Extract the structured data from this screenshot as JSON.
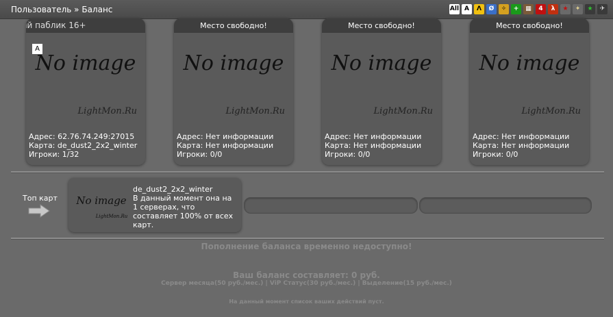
{
  "header": {
    "breadcrumb": "Пользователь » Баланс",
    "game_icons": [
      {
        "name": "all-games-icon",
        "glyph": "All",
        "bg": "#ffffff",
        "fg": "#000000"
      },
      {
        "name": "cs16-icon",
        "glyph": "A",
        "bg": "#ffffff",
        "fg": "#000000"
      },
      {
        "name": "cs16-alt-icon",
        "glyph": "Λ",
        "bg": "#f0c010",
        "fg": "#000000"
      },
      {
        "name": "source-icon",
        "glyph": "Ø",
        "bg": "#3a6fc8",
        "fg": "#ffffff"
      },
      {
        "name": "cs-go-icon",
        "glyph": "✧",
        "bg": "#d4a020",
        "fg": "#000000"
      },
      {
        "name": "mod-plus-icon",
        "glyph": "+",
        "bg": "#1a9a1a",
        "fg": "#ffffff"
      },
      {
        "name": "minecraft-icon",
        "glyph": "▦",
        "bg": "#7a5a3a",
        "fg": "#ffffff"
      },
      {
        "name": "l4d-icon",
        "glyph": "4",
        "bg": "#c01010",
        "fg": "#ffffff"
      },
      {
        "name": "hl-icon",
        "glyph": "λ",
        "bg": "#c03010",
        "fg": "#ffffff"
      },
      {
        "name": "red-star-icon",
        "glyph": "★",
        "bg": "#6a6a6a",
        "fg": "#c01010"
      },
      {
        "name": "sparkle-icon",
        "glyph": "✦",
        "bg": "#6a6a6a",
        "fg": "#e0d090"
      },
      {
        "name": "green-star-icon",
        "glyph": "★",
        "bg": "#3a3a3a",
        "fg": "#30c030"
      },
      {
        "name": "plane-icon",
        "glyph": "✈",
        "bg": "#3a3a3a",
        "fg": "#e0e0e0"
      }
    ]
  },
  "servers": [
    {
      "title": "ый паблик 16+",
      "image_text": "No image",
      "watermark": "LightMon.Ru",
      "address": "Адрес: 62.76.74.249:27015",
      "map": "Карта: de_dust2_2x2_winter",
      "players": "Игроки: 1/32",
      "has_mode_icon": true
    },
    {
      "title": "Место свободно!",
      "image_text": "No image",
      "watermark": "LightMon.Ru",
      "address": "Адрес: Нет информации",
      "map": "Карта: Нет информации",
      "players": "Игроки: 0/0",
      "has_mode_icon": false
    },
    {
      "title": "Место свободно!",
      "image_text": "No image",
      "watermark": "LightMon.Ru",
      "address": "Адрес: Нет информации",
      "map": "Карта: Нет информации",
      "players": "Игроки: 0/0",
      "has_mode_icon": false
    },
    {
      "title": "Место свободно!",
      "image_text": "No image",
      "watermark": "LightMon.Ru",
      "address": "Адрес: Нет информации",
      "map": "Карта: Нет информации",
      "players": "Игроки: 0/0",
      "has_mode_icon": false
    }
  ],
  "top_maps": {
    "label": "Топ карт",
    "item": {
      "image_text": "No image",
      "watermark": "LightMon.Ru",
      "name": "de_dust2_2x2_winter",
      "description": "В данный момент она на 1 серверах, что составляет 100% от всех карт."
    }
  },
  "balance": {
    "unavailable": "Пополнение баланса временно недоступно!",
    "balance_text": "Ваш баланс составляет: 0 руб.",
    "prices": "Сервер месяца(50 руб./мес.) | ViP Статус(30 руб./мес.) | Выделение(15 руб./мес.)",
    "empty_actions": "На данный момент список ваших действий пуст."
  },
  "colors": {
    "background": "#6a6a6a",
    "card": "#5a5a5a",
    "card_header": "#3e3e3e",
    "muted_text": "#8a8a8a"
  }
}
